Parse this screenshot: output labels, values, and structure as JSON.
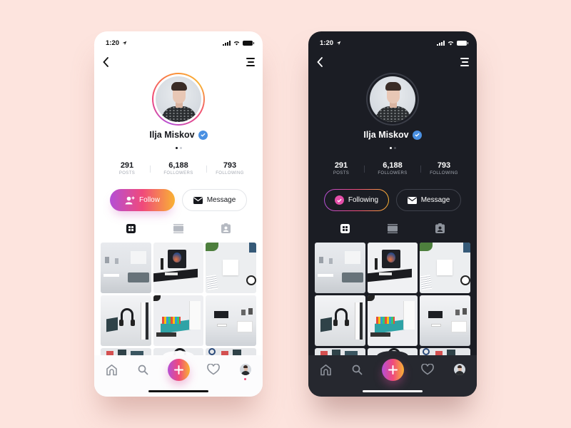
{
  "background_color": "#fde4de",
  "accent_gradient": [
    "#b44fd6",
    "#f0497b",
    "#f9b233"
  ],
  "phones": {
    "light": {
      "theme": "light",
      "status": {
        "time": "1:20",
        "location_icon": "location-arrow-icon",
        "signal_icon": "cellular-signal-icon",
        "wifi_icon": "wifi-icon",
        "battery_icon": "battery-icon"
      },
      "nav": {
        "back_icon": "chevron-left-icon",
        "menu_icon": "menu-icon"
      },
      "profile": {
        "name": "Ilja Miskov",
        "verified": true,
        "page_dots": 2,
        "active_dot": 1
      },
      "stats": [
        {
          "value": "291",
          "label": "POSTS"
        },
        {
          "value": "6,188",
          "label": "FOLLOWERS"
        },
        {
          "value": "793",
          "label": "FOLLOWING"
        }
      ],
      "primary_button": {
        "label": "Follow",
        "icon": "add-user-icon"
      },
      "secondary_button": {
        "label": "Message",
        "icon": "envelope-icon"
      },
      "tabs": [
        {
          "name": "grid",
          "icon": "grid-icon",
          "active": true
        },
        {
          "name": "feed",
          "icon": "list-view-icon",
          "active": false
        },
        {
          "name": "tagged",
          "icon": "tagged-person-icon",
          "active": false
        }
      ],
      "photos": [
        "living-room",
        "desk-monitor",
        "airpods-flatlay",
        "headphones-shelf",
        "desk-teal",
        "office-tv",
        "partial-1",
        "partial-2",
        "partial-3"
      ],
      "tabbar": [
        {
          "name": "home",
          "icon": "home-icon"
        },
        {
          "name": "search",
          "icon": "search-icon"
        },
        {
          "name": "add",
          "icon": "plus-icon"
        },
        {
          "name": "activity",
          "icon": "heart-icon"
        },
        {
          "name": "profile",
          "icon": "avatar-icon",
          "notification": true
        }
      ]
    },
    "dark": {
      "theme": "dark",
      "status": {
        "time": "1:20",
        "location_icon": "location-arrow-icon",
        "signal_icon": "cellular-signal-icon",
        "wifi_icon": "wifi-icon",
        "battery_icon": "battery-icon"
      },
      "nav": {
        "back_icon": "chevron-left-icon",
        "menu_icon": "menu-icon"
      },
      "profile": {
        "name": "Ilja Miskov",
        "verified": true,
        "page_dots": 2,
        "active_dot": 1
      },
      "stats": [
        {
          "value": "291",
          "label": "POSTS"
        },
        {
          "value": "6,188",
          "label": "FOLLOWERS"
        },
        {
          "value": "793",
          "label": "FOLLOWING"
        }
      ],
      "primary_button": {
        "label": "Following",
        "icon": "check-circle-icon"
      },
      "secondary_button": {
        "label": "Message",
        "icon": "envelope-icon"
      },
      "tabs": [
        {
          "name": "grid",
          "icon": "grid-icon",
          "active": true
        },
        {
          "name": "feed",
          "icon": "list-view-icon",
          "active": false
        },
        {
          "name": "tagged",
          "icon": "tagged-person-icon",
          "active": false
        }
      ],
      "photos": [
        "living-room",
        "desk-monitor",
        "airpods-flatlay",
        "headphones-shelf",
        "desk-teal",
        "office-tv",
        "partial-1",
        "partial-2",
        "partial-3"
      ],
      "tabbar": [
        {
          "name": "home",
          "icon": "home-icon"
        },
        {
          "name": "search",
          "icon": "search-icon"
        },
        {
          "name": "add",
          "icon": "plus-icon"
        },
        {
          "name": "activity",
          "icon": "heart-icon"
        },
        {
          "name": "profile",
          "icon": "avatar-icon",
          "notification": false
        }
      ]
    }
  }
}
